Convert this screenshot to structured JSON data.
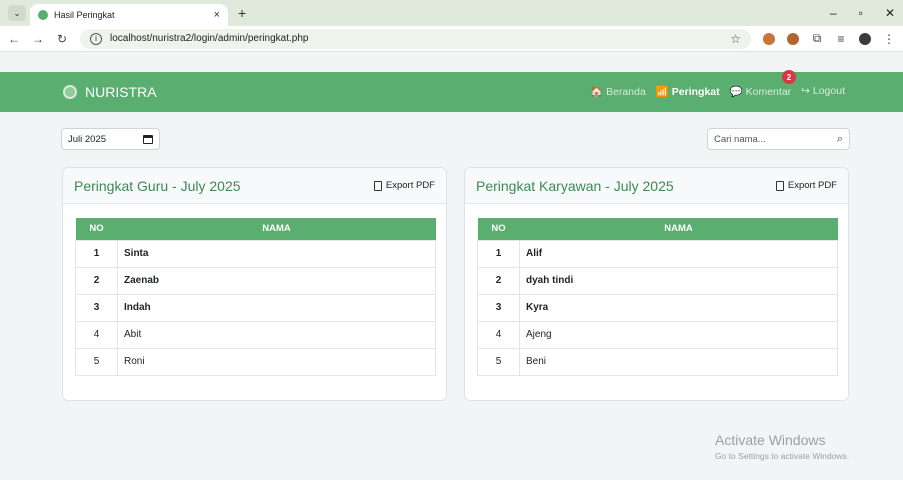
{
  "browser": {
    "tab_title": "Hasil Peringkat",
    "tab_close": "×",
    "new_tab": "+",
    "url": "localhost/nuristra2/login/admin/peringkat.php",
    "window_controls": [
      "–",
      "▫",
      "✕"
    ]
  },
  "navbar": {
    "brand": "NURISTRA",
    "links": [
      {
        "label": "🏠 Beranda"
      },
      {
        "label": "📶 Peringkat"
      },
      {
        "label": "💬 Komentar"
      },
      {
        "label": "↪ Logout"
      }
    ],
    "badge": "2",
    "colors": {
      "primary": "#5aae6f",
      "badge": "#dc3545"
    }
  },
  "filters": {
    "month_value": "Juli 2025",
    "search_placeholder": "Cari nama..."
  },
  "cards": [
    {
      "title": "Peringkat Guru - July 2025",
      "export_label": "Export PDF",
      "headers": [
        "NO",
        "NAMA"
      ],
      "rows": [
        {
          "no": "1",
          "nama": "Sinta"
        },
        {
          "no": "2",
          "nama": "Zaenab"
        },
        {
          "no": "3",
          "nama": "Indah"
        },
        {
          "no": "4",
          "nama": "Abit"
        },
        {
          "no": "5",
          "nama": "Roni"
        }
      ]
    },
    {
      "title": "Peringkat Karyawan - July 2025",
      "export_label": "Export PDF",
      "headers": [
        "NO",
        "NAMA"
      ],
      "rows": [
        {
          "no": "1",
          "nama": "Alif"
        },
        {
          "no": "2",
          "nama": "dyah tindi"
        },
        {
          "no": "3",
          "nama": "Kyra"
        },
        {
          "no": "4",
          "nama": "Ajeng"
        },
        {
          "no": "5",
          "nama": "Beni"
        }
      ]
    }
  ],
  "watermark": {
    "line1": "Activate Windows",
    "line2": "Go to Settings to activate Windows."
  }
}
